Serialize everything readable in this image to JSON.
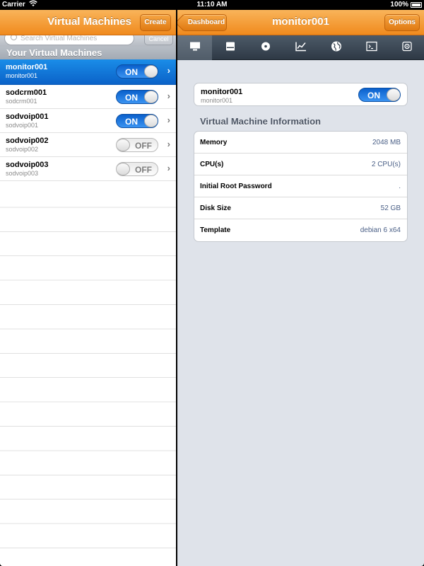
{
  "status_bar": {
    "carrier": "Carrier",
    "time": "11:10 AM",
    "battery": "100%"
  },
  "left_nav": {
    "title": "Virtual Machines",
    "create_label": "Create"
  },
  "search": {
    "placeholder": "Search Virtual Machines",
    "cancel_label": "Cancel"
  },
  "section_header": "Your Virtual Machines",
  "vms": [
    {
      "name": "monitor001",
      "sub": "monitor001",
      "state": "ON",
      "selected": true
    },
    {
      "name": "sodcrm001",
      "sub": "sodcrm001",
      "state": "ON",
      "selected": false
    },
    {
      "name": "sodvoip001",
      "sub": "sodvoip001",
      "state": "ON",
      "selected": false
    },
    {
      "name": "sodvoip002",
      "sub": "sodvoip002",
      "state": "OFF",
      "selected": false
    },
    {
      "name": "sodvoip003",
      "sub": "sodvoip003",
      "state": "OFF",
      "selected": false
    }
  ],
  "right_nav": {
    "back_label": "Dashboard",
    "title": "monitor001",
    "options_label": "Options"
  },
  "toolbar_tabs": [
    {
      "icon": "monitor-icon",
      "active": true
    },
    {
      "icon": "drive-icon",
      "active": false
    },
    {
      "icon": "disc-icon",
      "active": false
    },
    {
      "icon": "chart-icon",
      "active": false
    },
    {
      "icon": "globe-icon",
      "active": false
    },
    {
      "icon": "console-icon",
      "active": false
    },
    {
      "icon": "snapshot-icon",
      "active": false
    }
  ],
  "detail": {
    "name": "monitor001",
    "sub": "monitor001",
    "state": "ON",
    "info_heading": "Virtual Machine Information",
    "info": [
      {
        "key": "Memory",
        "value": "2048 MB"
      },
      {
        "key": "CPU(s)",
        "value": "2 CPU(s)"
      },
      {
        "key": "Initial Root Password",
        "value": "."
      },
      {
        "key": "Disk Size",
        "value": "52 GB"
      },
      {
        "key": "Template",
        "value": "debian 6 x64"
      }
    ]
  }
}
